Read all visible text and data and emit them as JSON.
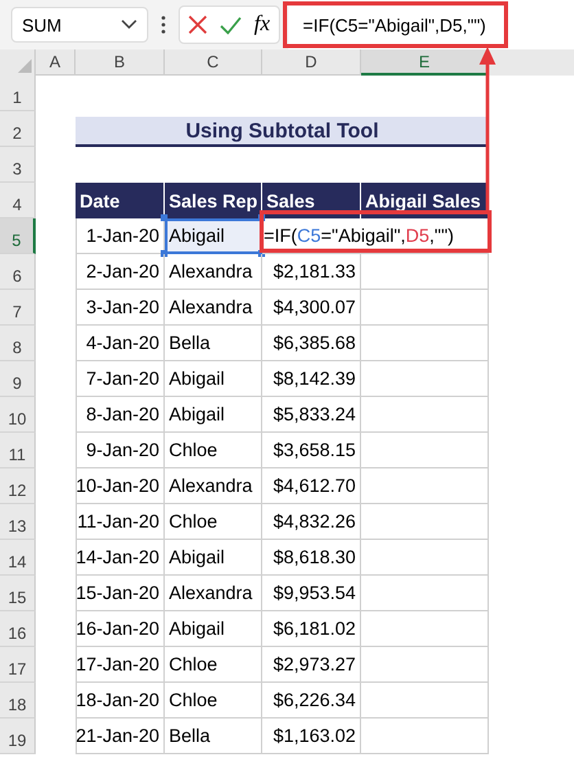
{
  "name_box": {
    "value": "SUM"
  },
  "formula_bar": {
    "function_button": "fx",
    "formula": "=IF(C5=\"Abigail\",D5,\"\")"
  },
  "columns": [
    {
      "label": "A",
      "selected": false
    },
    {
      "label": "B",
      "selected": false
    },
    {
      "label": "C",
      "selected": false
    },
    {
      "label": "D",
      "selected": false
    },
    {
      "label": "E",
      "selected": true
    }
  ],
  "row_numbers": [
    {
      "label": "1",
      "selected": false
    },
    {
      "label": "2",
      "selected": false
    },
    {
      "label": "3",
      "selected": false
    },
    {
      "label": "4",
      "selected": false
    },
    {
      "label": "5",
      "selected": true
    },
    {
      "label": "6",
      "selected": false
    },
    {
      "label": "7",
      "selected": false
    },
    {
      "label": "8",
      "selected": false
    },
    {
      "label": "9",
      "selected": false
    },
    {
      "label": "10",
      "selected": false
    },
    {
      "label": "11",
      "selected": false
    },
    {
      "label": "12",
      "selected": false
    },
    {
      "label": "13",
      "selected": false
    },
    {
      "label": "14",
      "selected": false
    },
    {
      "label": "15",
      "selected": false
    },
    {
      "label": "16",
      "selected": false
    },
    {
      "label": "17",
      "selected": false
    },
    {
      "label": "18",
      "selected": false
    },
    {
      "label": "19",
      "selected": false
    }
  ],
  "title": "Using Subtotal Tool",
  "table": {
    "columns": [
      "Date",
      "Sales Rep",
      "Sales",
      "Abigail Sales"
    ],
    "rows": [
      {
        "date": "1-Jan-20",
        "rep": "Abigail",
        "rep_referenced": true,
        "formula_parts": [
          {
            "text": "=IF(",
            "color": "#000000"
          },
          {
            "text": "C5",
            "color": "#3c78d8"
          },
          {
            "text": "=\"Abigail\",",
            "color": "#000000"
          },
          {
            "text": "D5",
            "color": "#e03c4c"
          },
          {
            "text": ",\"\")",
            "color": "#000000"
          }
        ]
      },
      {
        "date": "2-Jan-20",
        "rep": "Alexandra",
        "rep_referenced": false,
        "sales": "$2,181.33"
      },
      {
        "date": "3-Jan-20",
        "rep": "Alexandra",
        "rep_referenced": false,
        "sales": "$4,300.07"
      },
      {
        "date": "4-Jan-20",
        "rep": "Bella",
        "rep_referenced": false,
        "sales": "$6,385.68"
      },
      {
        "date": "7-Jan-20",
        "rep": "Abigail",
        "rep_referenced": false,
        "sales": "$8,142.39"
      },
      {
        "date": "8-Jan-20",
        "rep": "Abigail",
        "rep_referenced": false,
        "sales": "$5,833.24"
      },
      {
        "date": "9-Jan-20",
        "rep": "Chloe",
        "rep_referenced": false,
        "sales": "$3,658.15"
      },
      {
        "date": "10-Jan-20",
        "rep": "Alexandra",
        "rep_referenced": false,
        "sales": "$4,612.70"
      },
      {
        "date": "11-Jan-20",
        "rep": "Chloe",
        "rep_referenced": false,
        "sales": "$4,832.26"
      },
      {
        "date": "14-Jan-20",
        "rep": "Abigail",
        "rep_referenced": false,
        "sales": "$8,618.30"
      },
      {
        "date": "15-Jan-20",
        "rep": "Alexandra",
        "rep_referenced": false,
        "sales": "$9,953.54"
      },
      {
        "date": "16-Jan-20",
        "rep": "Abigail",
        "rep_referenced": false,
        "sales": "$6,181.02"
      },
      {
        "date": "17-Jan-20",
        "rep": "Chloe",
        "rep_referenced": false,
        "sales": "$2,973.27"
      },
      {
        "date": "18-Jan-20",
        "rep": "Chloe",
        "rep_referenced": false,
        "sales": "$6,226.34"
      },
      {
        "date": "21-Jan-20",
        "rep": "Bella",
        "rep_referenced": false,
        "sales": "$1,163.02"
      }
    ]
  }
}
